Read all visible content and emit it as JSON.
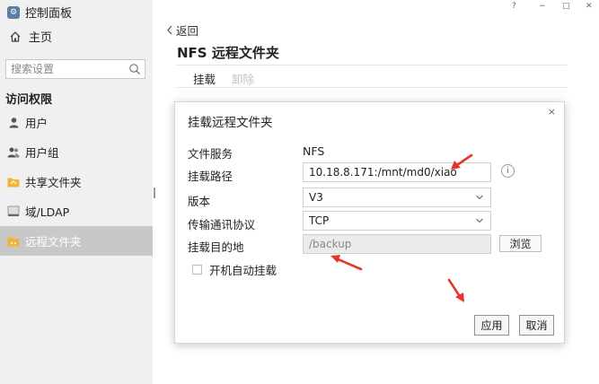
{
  "app": {
    "title": "控制面板",
    "icon": "control-panel-icon"
  },
  "window": {
    "help": "?",
    "minimize": "−",
    "maximize": "□",
    "close": "✕"
  },
  "sidebar": {
    "home": "主页",
    "search_placeholder": "搜索设置",
    "section": "访问权限",
    "items": [
      {
        "label": "用户",
        "icon": "user-icon"
      },
      {
        "label": "用户组",
        "icon": "user-group-icon"
      },
      {
        "label": "共享文件夹",
        "icon": "shared-folder-icon"
      },
      {
        "label": "域/LDAP",
        "icon": "ldap-icon"
      },
      {
        "label": "远程文件夹",
        "icon": "remote-folder-icon",
        "active": true
      }
    ]
  },
  "main": {
    "back": "返回",
    "title": "NFS 远程文件夹",
    "tabs": [
      {
        "label": "挂载"
      },
      {
        "label": "卸除"
      }
    ]
  },
  "dialog": {
    "title": "挂载远程文件夹",
    "close": "×",
    "fields": {
      "service_label": "文件服务",
      "service_value": "NFS",
      "path_label": "挂载路径",
      "path_value": "10.18.8.171:/mnt/md0/xiao",
      "version_label": "版本",
      "version_value": "V3",
      "protocol_label": "传输通讯协议",
      "protocol_value": "TCP",
      "target_label": "挂载目的地",
      "target_placeholder": "/backup"
    },
    "info": "i",
    "browse": "浏览",
    "auto_mount": "开机自动挂载",
    "apply": "应用",
    "cancel": "取消"
  },
  "colors": {
    "annotation_arrow": "#e8342a",
    "active_nav": "#c8c8c8",
    "sidebar_bg": "#f0f0f0"
  }
}
